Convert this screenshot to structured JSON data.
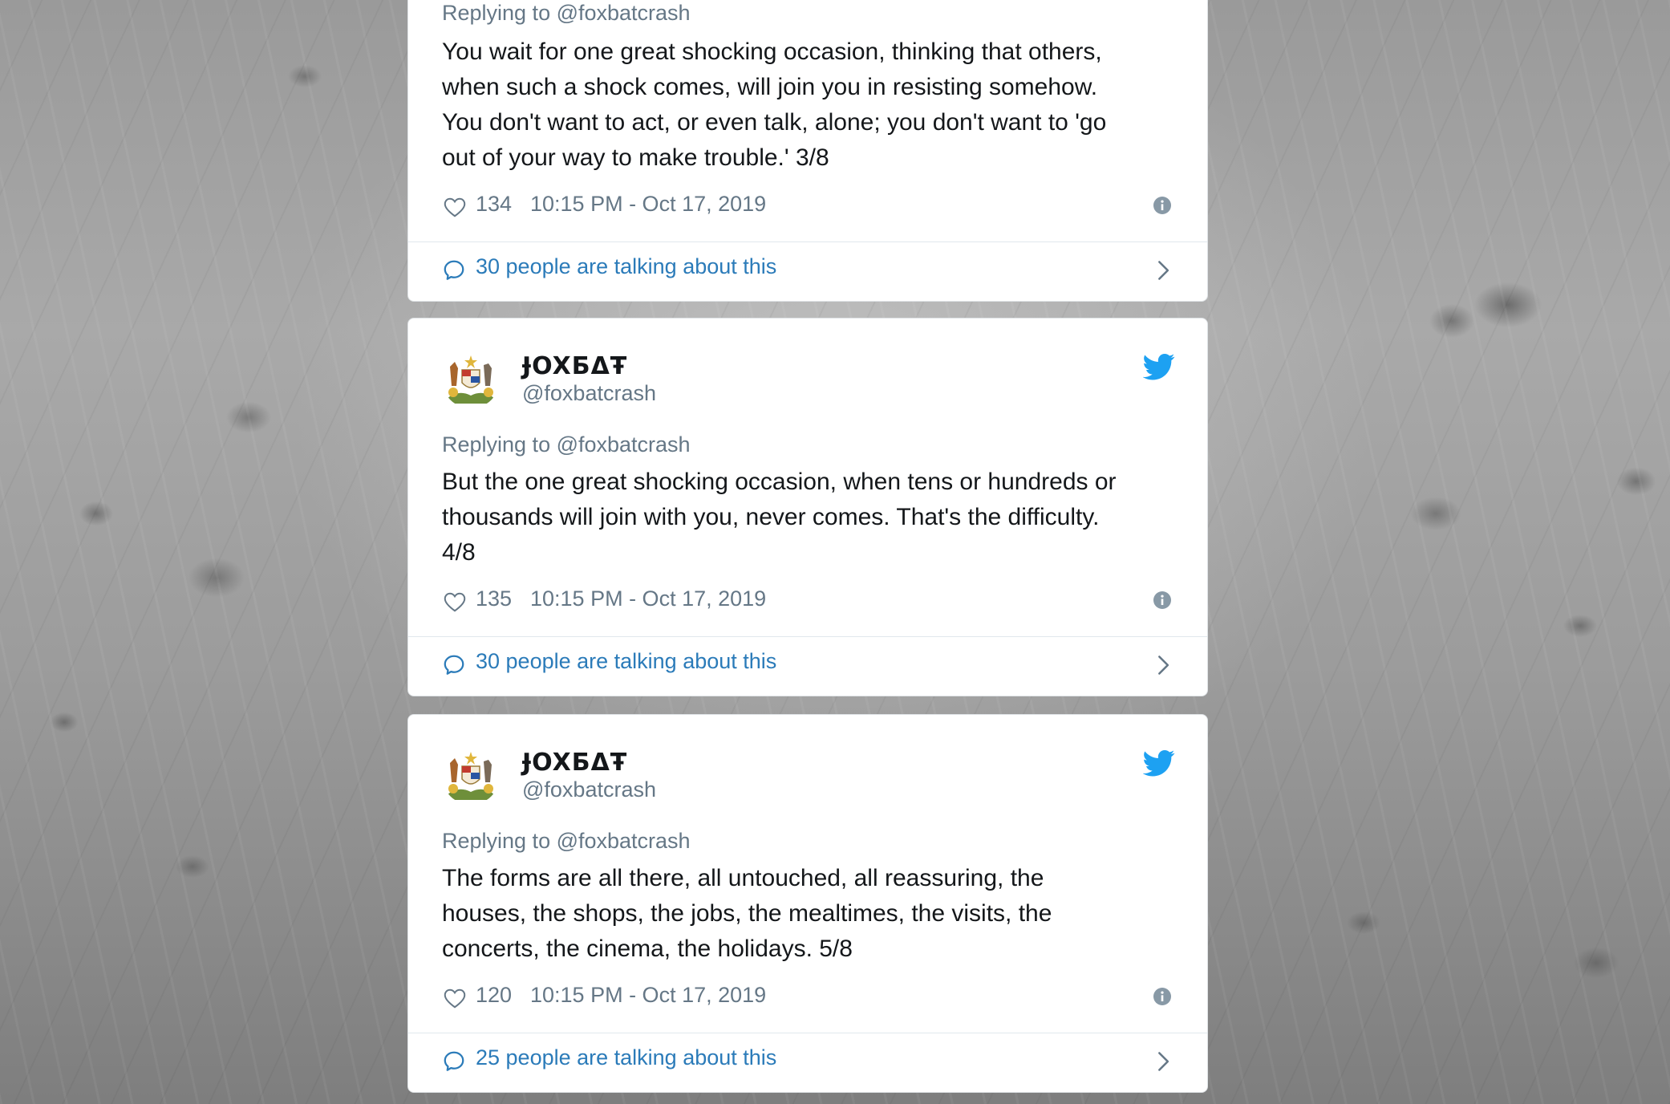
{
  "tweets": [
    {
      "display_name": "",
      "screen_name": "",
      "replying_to": "Replying to @foxbatcrash",
      "text_lines": [
        "You wait for one great shocking occasion, thinking that others,",
        "when such a shock comes, will join you in resisting somehow.",
        "You don't want to act, or even talk, alone; you don't want to 'go",
        "out of your way to make trouble.'  3/8"
      ],
      "likes": "134",
      "timestamp": "10:15 PM - Oct 17, 2019",
      "talking": "30 people are talking about this"
    },
    {
      "display_name": "ɈOXБΔŦ",
      "screen_name": "@foxbatcrash",
      "replying_to": "Replying to @foxbatcrash",
      "text_lines": [
        "But the one great shocking occasion, when tens or hundreds or",
        "thousands will join with you, never comes. That's the difficulty.",
        "4/8"
      ],
      "likes": "135",
      "timestamp": "10:15 PM - Oct 17, 2019",
      "talking": "30 people are talking about this"
    },
    {
      "display_name": "ɈOXБΔŦ",
      "screen_name": "@foxbatcrash",
      "replying_to": "Replying to @foxbatcrash",
      "text_lines": [
        "The forms are all there, all untouched, all reassuring, the",
        "houses, the shops, the jobs, the mealtimes, the visits, the",
        "concerts, the cinema, the holidays. 5/8"
      ],
      "likes": "120",
      "timestamp": "10:15 PM - Oct 17, 2019",
      "talking": "25 people are talking about this"
    }
  ],
  "icons": {
    "like": "heart-icon",
    "info": "info-icon",
    "conversation": "speech-bubble-icon",
    "more": "chevron-right-icon",
    "brand": "twitter-bird-icon",
    "avatar": "coat-of-arms-avatar"
  },
  "colors": {
    "link": "#2b7bb9",
    "twitter_blue": "#1da1f2",
    "secondary_text": "#657786",
    "primary_text": "#14171a"
  }
}
